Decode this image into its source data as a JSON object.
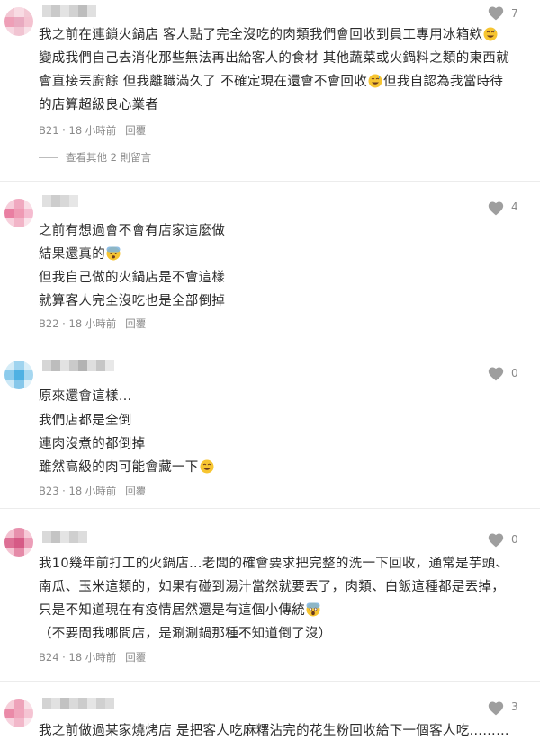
{
  "comments": [
    {
      "likes": "7",
      "lines": [
        "我之前在連鎖火鍋店 客人點了完全沒吃的肉類我們會回收到員工專用冰箱欸",
        "變成我們自己去消化那些無法再出給客人的食材 其他蔬菜或火鍋料之類的東西就",
        "會直接丟廚餘 但我離職滿久了 不確定現在還會不會回收",
        "的店算超級良心業者"
      ],
      "line3_tail": "但我自認為我當時待",
      "floor": "B21",
      "time": "18 小時前",
      "reply": "回覆",
      "more_replies": "查看其他 2 則留言"
    },
    {
      "likes": "4",
      "lines": [
        "之前有想過會不會有店家這麼做",
        "結果還真的",
        "但我自己做的火鍋店是不會這樣",
        "就算客人完全沒吃也是全部倒掉"
      ],
      "floor": "B22",
      "time": "18 小時前",
      "reply": "回覆"
    },
    {
      "likes": "0",
      "lines": [
        "原來還會這樣…",
        "我們店都是全倒",
        "連肉沒煮的都倒掉",
        "雖然高級的肉可能會藏一下"
      ],
      "floor": "B23",
      "time": "18 小時前",
      "reply": "回覆"
    },
    {
      "likes": "0",
      "lines": [
        "我10幾年前打工的火鍋店…老闆的確會要求把完整的洗一下回收，通常是芋頭、",
        "南瓜、玉米這類的，如果有碰到湯汁當然就要丟了，肉類、白飯這種都是丟掉，",
        "只是不知道現在有疫情居然還是有這個小傳統",
        "（不要問我哪間店，是涮涮鍋那種不知道倒了沒）"
      ],
      "floor": "B24",
      "time": "18 小時前",
      "reply": "回覆"
    },
    {
      "likes": "3",
      "lines": [
        "我之前做過某家燒烤店 是把客人吃麻糬沾完的花生粉回收給下一個客人吃………"
      ]
    }
  ],
  "icons": {
    "like": "heart-icon",
    "laugh": "grinning-sweat-emoji",
    "shock": "fearful-face-emoji",
    "scream": "screaming-face-emoji"
  },
  "colors": {
    "text": "#2b2b2b",
    "muted": "#8a8a8a",
    "heart": "#9e9e9e",
    "divider": "#ececec"
  }
}
